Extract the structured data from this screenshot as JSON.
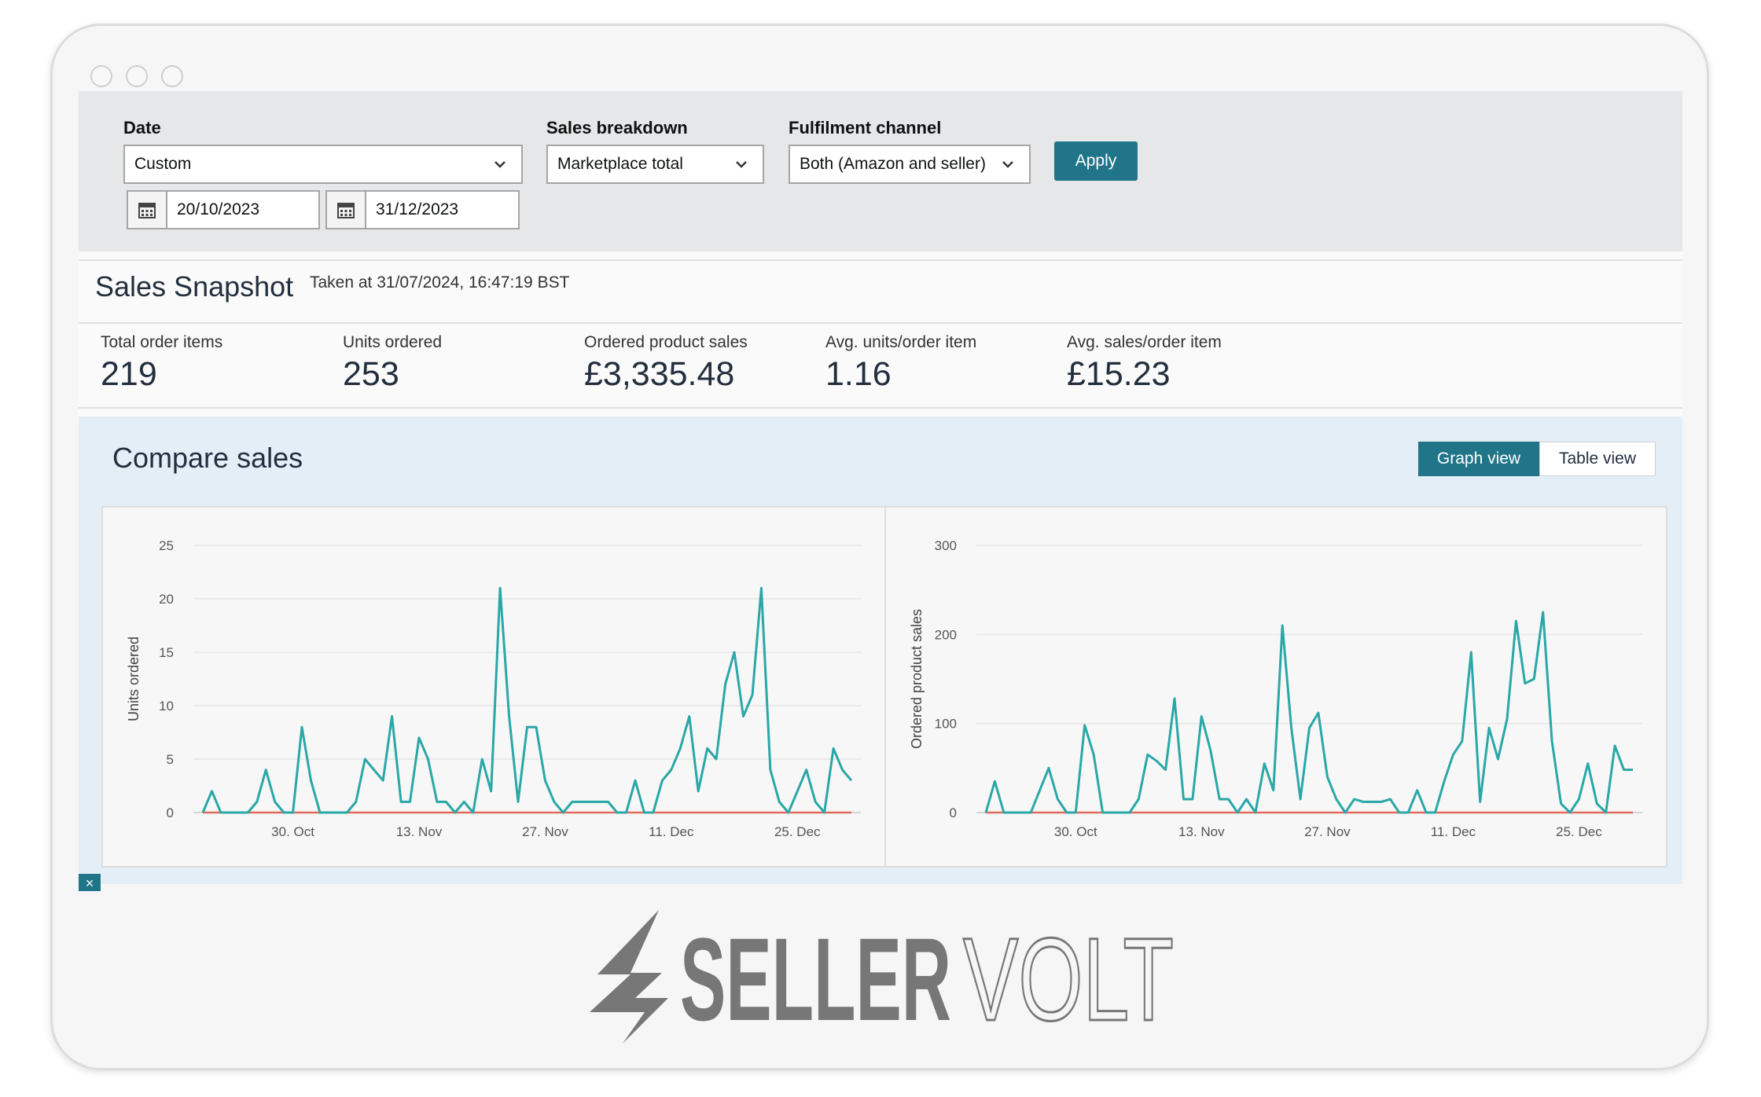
{
  "window": {
    "dots": [
      "",
      "",
      ""
    ]
  },
  "filters": {
    "date": {
      "label": "Date",
      "value": "Custom"
    },
    "start_date": "20/10/2023",
    "end_date": "31/12/2023",
    "sales_breakdown": {
      "label": "Sales breakdown",
      "value": "Marketplace total"
    },
    "fulfilment_channel": {
      "label": "Fulfilment channel",
      "value": "Both (Amazon and seller)"
    },
    "apply_label": "Apply"
  },
  "snapshot": {
    "title": "Sales Snapshot",
    "taken_at": "Taken at 31/07/2024, 16:47:19 BST",
    "metrics": [
      {
        "label": "Total order items",
        "value": "219"
      },
      {
        "label": "Units ordered",
        "value": "253"
      },
      {
        "label": "Ordered product sales",
        "value": "£3,335.48"
      },
      {
        "label": "Avg. units/order item",
        "value": "1.16"
      },
      {
        "label": "Avg. sales/order item",
        "value": "£15.23"
      }
    ]
  },
  "compare": {
    "title": "Compare sales",
    "graph_view_label": "Graph view",
    "table_view_label": "Table view",
    "close_label": "×"
  },
  "colors": {
    "accent": "#217588",
    "series_current": "#2aa7a7",
    "series_compare": "#e06b5f"
  },
  "chart_data": [
    {
      "type": "line",
      "ylabel": "Units ordered",
      "ylim": [
        0,
        25
      ],
      "yticks": [
        "0",
        "5",
        "10",
        "15",
        "20",
        "25"
      ],
      "xticks": [
        {
          "label": "30. Oct",
          "x": 10
        },
        {
          "label": "13. Nov",
          "x": 24
        },
        {
          "label": "27. Nov",
          "x": 38
        },
        {
          "label": "11. Dec",
          "x": 52
        },
        {
          "label": "25. Dec",
          "x": 66
        }
      ],
      "x_range": [
        0,
        72
      ],
      "series": [
        {
          "values": [
            0,
            2,
            0,
            0,
            0,
            0,
            1,
            4,
            1,
            0,
            0,
            8,
            3,
            0,
            0,
            0,
            0,
            1,
            5,
            4,
            3,
            9,
            1,
            1,
            7,
            5,
            1,
            1,
            0,
            1,
            0,
            5,
            2,
            21,
            9,
            1,
            8,
            8,
            3,
            1,
            0,
            1,
            1,
            1,
            1,
            1,
            0,
            0,
            3,
            0,
            0,
            3,
            4,
            6,
            9,
            2,
            6,
            5,
            12,
            15,
            9,
            11,
            21,
            4,
            1,
            0,
            2,
            4,
            1,
            0,
            6,
            4,
            3
          ]
        },
        {
          "values": [
            0,
            0,
            0,
            0,
            0,
            0,
            0,
            0,
            0,
            0,
            0,
            0,
            0,
            0,
            0,
            0,
            0,
            0,
            0,
            0,
            0,
            0,
            0,
            0,
            0,
            0,
            0,
            0,
            0,
            0,
            0,
            0,
            0,
            0,
            0,
            0,
            0,
            0,
            0,
            0,
            0,
            0,
            0,
            0,
            0,
            0,
            0,
            0,
            0,
            0,
            0,
            0,
            0,
            0,
            0,
            0,
            0,
            0,
            0,
            0,
            0,
            0,
            0,
            0,
            0,
            0,
            0,
            0,
            0,
            0,
            0,
            0,
            0
          ]
        }
      ]
    },
    {
      "type": "line",
      "ylabel": "Ordered product sales",
      "ylim": [
        0,
        300
      ],
      "yticks": [
        "0",
        "100",
        "200",
        "300"
      ],
      "xticks": [
        {
          "label": "30. Oct",
          "x": 10
        },
        {
          "label": "13. Nov",
          "x": 24
        },
        {
          "label": "27. Nov",
          "x": 38
        },
        {
          "label": "11. Dec",
          "x": 52
        },
        {
          "label": "25. Dec",
          "x": 66
        }
      ],
      "x_range": [
        0,
        72
      ],
      "series": [
        {
          "values": [
            0,
            35,
            0,
            0,
            0,
            0,
            25,
            50,
            15,
            0,
            0,
            98,
            65,
            0,
            0,
            0,
            0,
            15,
            65,
            58,
            48,
            128,
            15,
            15,
            108,
            70,
            15,
            15,
            0,
            15,
            0,
            55,
            25,
            210,
            95,
            15,
            95,
            112,
            40,
            15,
            0,
            15,
            12,
            12,
            12,
            15,
            0,
            0,
            25,
            0,
            0,
            35,
            65,
            80,
            180,
            12,
            95,
            60,
            105,
            215,
            145,
            150,
            225,
            80,
            10,
            0,
            15,
            55,
            10,
            0,
            75,
            48,
            48
          ]
        },
        {
          "values": [
            0,
            0,
            0,
            0,
            0,
            0,
            0,
            0,
            0,
            0,
            0,
            0,
            0,
            0,
            0,
            0,
            0,
            0,
            0,
            0,
            0,
            0,
            0,
            0,
            0,
            0,
            0,
            0,
            0,
            0,
            0,
            0,
            0,
            0,
            0,
            0,
            0,
            0,
            0,
            0,
            0,
            0,
            0,
            0,
            0,
            0,
            0,
            0,
            0,
            0,
            0,
            0,
            0,
            0,
            0,
            0,
            0,
            0,
            0,
            0,
            0,
            0,
            0,
            0,
            0,
            0,
            0,
            0,
            0,
            0,
            0,
            0,
            0
          ]
        }
      ]
    }
  ]
}
